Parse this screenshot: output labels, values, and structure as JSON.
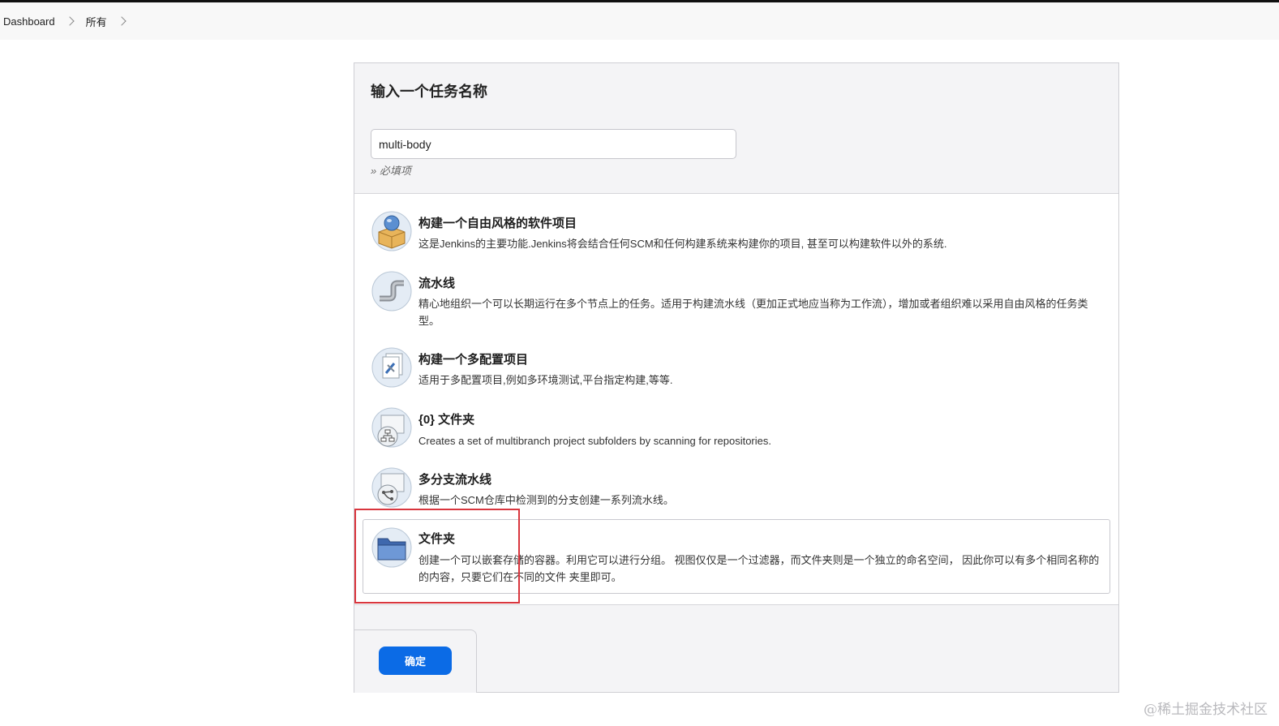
{
  "breadcrumb": {
    "items": [
      "Dashboard",
      "所有"
    ]
  },
  "form": {
    "title": "输入一个任务名称",
    "name_value": "multi-body",
    "required_hint": "» 必填项"
  },
  "items": [
    {
      "title": "构建一个自由风格的软件项目",
      "desc": "这是Jenkins的主要功能.Jenkins将会结合任何SCM和任何构建系统来构建你的项目, 甚至可以构建软件以外的系统."
    },
    {
      "title": "流水线",
      "desc": "精心地组织一个可以长期运行在多个节点上的任务。适用于构建流水线（更加正式地应当称为工作流），增加或者组织难以采用自由风格的任务类型。"
    },
    {
      "title": "构建一个多配置项目",
      "desc": "适用于多配置项目,例如多环境测试,平台指定构建,等等."
    },
    {
      "title": "{0} 文件夹",
      "desc": "Creates a set of multibranch project subfolders by scanning for repositories."
    },
    {
      "title": "多分支流水线",
      "desc": "根据一个SCM仓库中检测到的分支创建一系列流水线。"
    },
    {
      "title": "文件夹",
      "desc": "创建一个可以嵌套存储的容器。利用它可以进行分组。 视图仅仅是一个过滤器，而文件夹则是一个独立的命名空间， 因此你可以有多个相同名称的的内容，只要它们在不同的文件 夹里即可。"
    }
  ],
  "ok_button": "确定",
  "watermark": "@稀土掘金技术社区",
  "colors": {
    "primary": "#0b6be6",
    "highlight": "#d9363e"
  }
}
